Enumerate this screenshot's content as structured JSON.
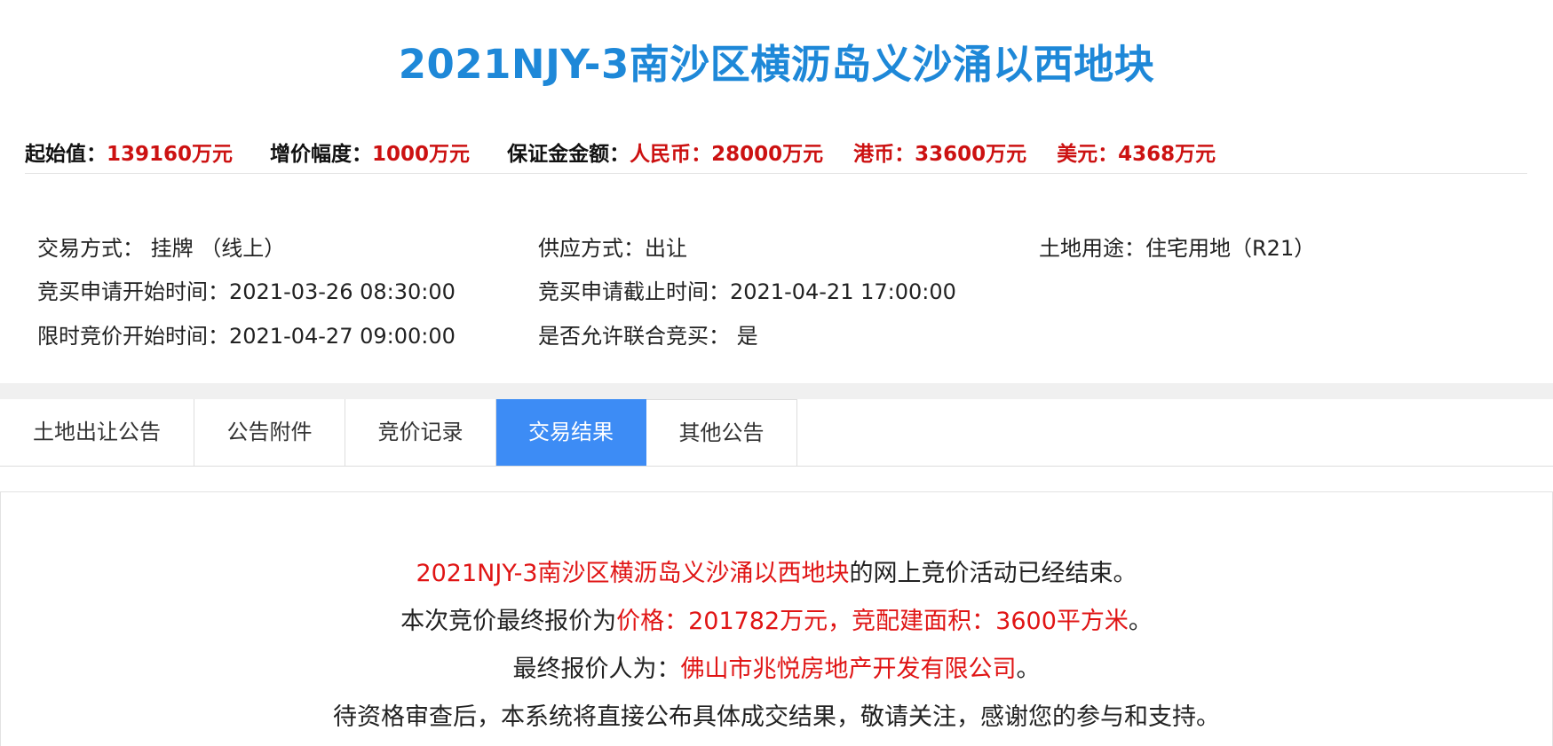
{
  "title": "2021NJY-3南沙区横沥岛义沙涌以西地块",
  "price": {
    "start_label": "起始值：",
    "start_value": "139160万元",
    "increment_label": "增价幅度：",
    "increment_value": "1000万元",
    "deposit_label": "保证金金额：",
    "rmb_label": "人民币：",
    "rmb_value": "28000万元",
    "hkd_label": "港币：",
    "hkd_value": "33600万元",
    "usd_label": "美元：",
    "usd_value": "4368万元"
  },
  "info": {
    "trade_method": "交易方式：  挂牌  （线上）",
    "supply_method": "供应方式：出让",
    "land_use": "土地用途：住宅用地（R21）",
    "apply_start": "竞买申请开始时间：2021-03-26 08:30:00",
    "apply_end": "竞买申请截止时间：2021-04-21 17:00:00",
    "bid_start": "限时竞价开始时间：2021-04-27 09:00:00",
    "joint_bid": "是否允许联合竞买：  是"
  },
  "tabs": [
    "土地出让公告",
    "公告附件",
    "竞价记录",
    "交易结果",
    "其他公告"
  ],
  "active_tab": "交易结果",
  "result": {
    "line1_parcel": "2021NJY-3南沙区横沥岛义沙涌以西地块",
    "line1_suffix": "的网上竞价活动已经结束。",
    "line2_prefix": "本次竞价最终报价为",
    "line2_value": "价格：201782万元，竞配建面积：3600平方米",
    "line2_suffix": "。",
    "line3_prefix": "最终报价人为：",
    "line3_winner": "佛山市兆悦房地产开发有限公司",
    "line3_suffix": "。",
    "line4": "待资格审查后，本系统将直接公布具体成交结果，敬请关注，感谢您的参与和支持。"
  },
  "colors": {
    "title": "#1e88d8",
    "value_red": "#cc1111",
    "active_tab": "#3d8cf5"
  }
}
